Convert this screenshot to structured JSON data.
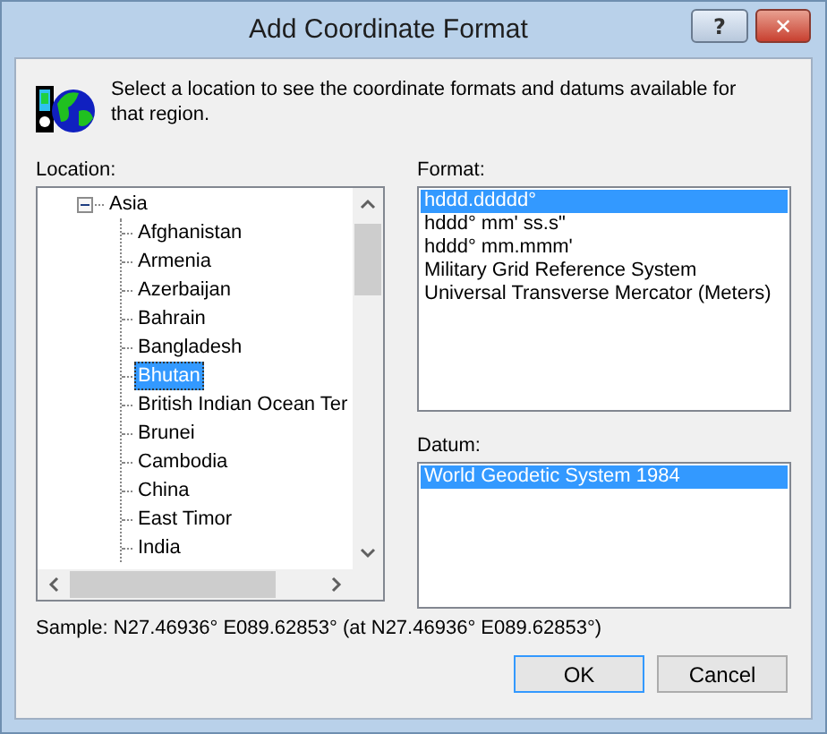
{
  "window": {
    "title": "Add Coordinate Format",
    "help_button": "?",
    "close_button": "✕"
  },
  "description": "Select a location to see the coordinate formats and datums available for that region.",
  "location": {
    "label": "Location:",
    "tree": [
      {
        "label": "Asia",
        "expanded": true,
        "children": [
          {
            "label": "Afghanistan",
            "selected": false
          },
          {
            "label": "Armenia",
            "selected": false
          },
          {
            "label": "Azerbaijan",
            "selected": false
          },
          {
            "label": "Bahrain",
            "selected": false
          },
          {
            "label": "Bangladesh",
            "selected": false
          },
          {
            "label": "Bhutan",
            "selected": true
          },
          {
            "label": "British Indian Ocean Ter",
            "selected": false
          },
          {
            "label": "Brunei",
            "selected": false
          },
          {
            "label": "Cambodia",
            "selected": false
          },
          {
            "label": "China",
            "selected": false
          },
          {
            "label": "East Timor",
            "selected": false
          },
          {
            "label": "India",
            "selected": false
          }
        ]
      }
    ]
  },
  "format": {
    "label": "Format:",
    "items": [
      {
        "label": "hddd.ddddd°",
        "selected": true
      },
      {
        "label": "hddd° mm' ss.s\"",
        "selected": false
      },
      {
        "label": "hddd° mm.mmm'",
        "selected": false
      },
      {
        "label": "Military Grid Reference System",
        "selected": false
      },
      {
        "label": "Universal Transverse Mercator (Meters)",
        "selected": false
      }
    ]
  },
  "datum": {
    "label": "Datum:",
    "items": [
      {
        "label": "World Geodetic System 1984",
        "selected": true
      }
    ]
  },
  "sample": "Sample: N27.46936°  E089.62853° (at N27.46936°  E089.62853°)",
  "buttons": [
    {
      "label": "OK",
      "default": true
    },
    {
      "label": "Cancel",
      "default": false
    }
  ]
}
